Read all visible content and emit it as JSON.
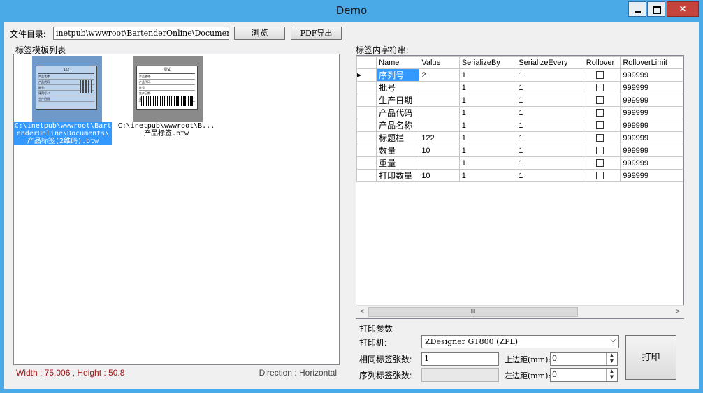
{
  "window": {
    "title": "Demo"
  },
  "toolbar": {
    "dir_label": "文件目录:",
    "dir_value": "inetpub\\wwwroot\\BartenderOnline\\Documents",
    "browse_label": "浏览",
    "pdf_label": "PDF导出"
  },
  "left": {
    "section_label": "标签模板列表",
    "templates": [
      {
        "caption_lines": [
          "C:\\inetpub\\wwwroot\\Bart",
          "enderOnline\\Documents\\",
          "产品标签(2维码).btw"
        ],
        "thumb_title": "122",
        "thumb_fields": [
          "产品名称:",
          "产品代码:",
          "批号:",
          "序列号: 2",
          "生产日期:"
        ],
        "selected": true
      },
      {
        "caption_lines": [
          "C:\\inetpub\\wwwroot\\B...",
          "产品标签.btw"
        ],
        "thumb_title": "测试",
        "thumb_fields": [
          "产品名称:",
          "产品代码:",
          "批号:",
          "生产日期:",
          "重量: kk"
        ],
        "selected": false
      }
    ],
    "status_size": "Width : 75.006 , Height : 50.8",
    "status_direction": "Direction : Horizontal"
  },
  "right": {
    "section_label": "标签内字符串:",
    "columns": [
      "Name",
      "Value",
      "SerializeBy",
      "SerializeEvery",
      "Rollover",
      "RolloverLimit"
    ],
    "rows": [
      {
        "name": "序列号",
        "value": "2",
        "by": "1",
        "every": "1",
        "rollover": false,
        "limit": "999999"
      },
      {
        "name": "批号",
        "value": "",
        "by": "1",
        "every": "1",
        "rollover": false,
        "limit": "999999"
      },
      {
        "name": "生产日期",
        "value": "",
        "by": "1",
        "every": "1",
        "rollover": false,
        "limit": "999999"
      },
      {
        "name": "产品代码",
        "value": "",
        "by": "1",
        "every": "1",
        "rollover": false,
        "limit": "999999"
      },
      {
        "name": "产品名称",
        "value": "",
        "by": "1",
        "every": "1",
        "rollover": false,
        "limit": "999999"
      },
      {
        "name": "标题栏",
        "value": "122",
        "by": "1",
        "every": "1",
        "rollover": false,
        "limit": "999999"
      },
      {
        "name": "数量",
        "value": "10",
        "by": "1",
        "every": "1",
        "rollover": false,
        "limit": "999999"
      },
      {
        "name": "重量",
        "value": "",
        "by": "1",
        "every": "1",
        "rollover": false,
        "limit": "999999"
      },
      {
        "name": "打印数量",
        "value": "10",
        "by": "1",
        "every": "1",
        "rollover": false,
        "limit": "999999"
      }
    ],
    "scroll_left": "<",
    "scroll_right": ">",
    "scroll_thumb": "III"
  },
  "print": {
    "group_label": "打印参数",
    "printer_label": "打印机:",
    "printer_value": "ZDesigner GT800 (ZPL)",
    "same_count_label": "相同标签张数:",
    "same_count_value": "1",
    "serial_count_label": "序列标签张数:",
    "serial_count_value": "",
    "top_margin_label": "上边距(mm):",
    "top_margin_value": "0",
    "left_margin_label": "左边距(mm):",
    "left_margin_value": "0",
    "print_button": "打印"
  },
  "colors": {
    "accent": "#4aaae8",
    "selection": "#3399ff",
    "status_text": "#a31515"
  }
}
